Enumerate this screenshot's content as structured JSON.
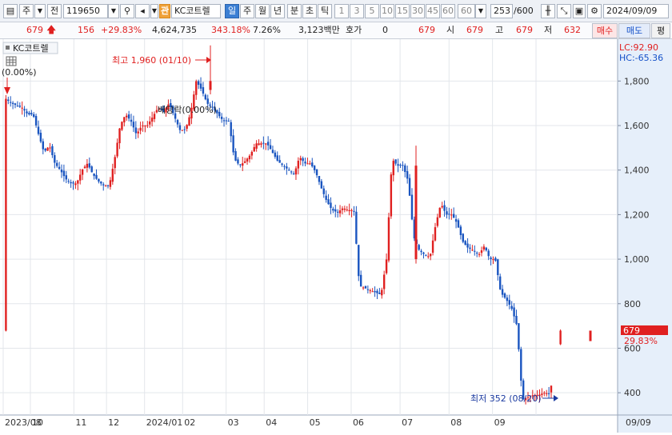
{
  "toolbar": {
    "market": "주",
    "prev": "전",
    "code": "119650",
    "brand_badge": "관",
    "name": "KC코트렐",
    "periods": [
      "일",
      "주",
      "월",
      "년",
      "분",
      "초",
      "틱"
    ],
    "active_period": "일",
    "intervals": [
      "1",
      "3",
      "5",
      "10",
      "15",
      "30",
      "45",
      "60"
    ],
    "custom_interval": "60",
    "count": "253",
    "total": "/600",
    "date": "2024/09/09"
  },
  "infobar": {
    "price": "679",
    "change": "156",
    "change_pct": "+29.83%",
    "volume": "4,624,735",
    "volume_ratio": "343.18%",
    "turnover": "7.26%",
    "amount": "3,123백만",
    "quote_label": "호가",
    "quote_value": "0",
    "ask_price": "679",
    "open_label": "시",
    "open": "679",
    "high_label": "고",
    "high": "679",
    "low_label": "저",
    "low": "632",
    "buy_label": "매수",
    "sell_label": "매도",
    "extra_label": "평"
  },
  "chart_data": {
    "type": "candlestick",
    "title": "KC코트렐",
    "series_label": "(0.00%)",
    "indicator_lc": "LC:92.90",
    "indicator_hc": "HC:-65.36",
    "ylim": [
      300,
      1970
    ],
    "yticks": [
      400,
      600,
      800,
      1000,
      1200,
      1400,
      1600,
      1800
    ],
    "ytick_labels": [
      "400",
      "600",
      "800",
      "1,000",
      "1,200",
      "1,400",
      "1,600",
      "1,800"
    ],
    "x_labels": [
      "2023/08",
      "10",
      "11",
      "12",
      "2024/01",
      "02",
      "03",
      "04",
      "05",
      "06",
      "07",
      "08",
      "09"
    ],
    "x_end_label": "09/09",
    "current_price_label": "679",
    "current_change_label": "29.83%",
    "high_annotation": "최고 1,960 (01/10)",
    "low_annotation": "최저 352 (08/20)",
    "dividend_annotation": "배당락(0.00%)",
    "up_color": "#e02020",
    "down_color": "#1a55c0",
    "monthly_path": [
      {
        "month": "2023/08",
        "values": [
          1720,
          1700,
          1690,
          1680,
          1650
        ]
      },
      {
        "month": "2023/09",
        "values": [
          1650,
          1560,
          1480,
          1510,
          1430,
          1400,
          1360,
          1340
        ]
      },
      {
        "month": "2023/10",
        "values": [
          1340,
          1400,
          1430,
          1380,
          1350,
          1330
        ]
      },
      {
        "month": "2023/11",
        "values": [
          1330,
          1450,
          1600,
          1650,
          1620,
          1560,
          1600
        ]
      },
      {
        "month": "2023/12",
        "values": [
          1600,
          1640,
          1680,
          1660,
          1700,
          1640,
          1580
        ]
      },
      {
        "month": "2024/01",
        "values": [
          1580,
          1660,
          1800,
          1760,
          1700,
          1680,
          1650,
          1620
        ]
      },
      {
        "month": "2024/02",
        "values": [
          1620,
          1450,
          1420,
          1440,
          1470,
          1520,
          1520
        ]
      },
      {
        "month": "2024/03",
        "values": [
          1520,
          1480,
          1440,
          1420,
          1400,
          1380,
          1460,
          1430
        ]
      },
      {
        "month": "2024/04",
        "values": [
          1430,
          1390,
          1320,
          1260,
          1220,
          1210,
          1230,
          1220
        ]
      },
      {
        "month": "2024/05",
        "values": [
          1220,
          880,
          870,
          860,
          850,
          840,
          1000,
          1450,
          1420
        ]
      },
      {
        "month": "2024/06",
        "values": [
          1420,
          1350,
          1100,
          1040,
          1020,
          1010,
          1150,
          1250,
          1200
        ]
      },
      {
        "month": "2024/07",
        "values": [
          1200,
          1160,
          1080,
          1050,
          1040,
          1020,
          1060,
          1000
        ]
      },
      {
        "month": "2024/08",
        "values": [
          1000,
          850,
          820,
          780,
          700,
          370,
          380,
          390
        ]
      },
      {
        "month": "2024/09",
        "values": [
          390,
          400,
          395,
          520,
          679
        ]
      }
    ]
  }
}
